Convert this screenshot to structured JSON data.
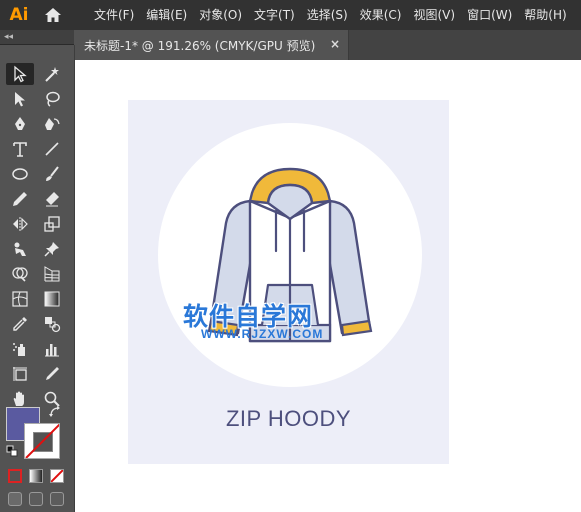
{
  "app": {
    "logo": "Ai"
  },
  "menu": [
    "文件(F)",
    "编辑(E)",
    "对象(O)",
    "文字(T)",
    "选择(S)",
    "效果(C)",
    "视图(V)",
    "窗口(W)",
    "帮助(H)"
  ],
  "document_tab": {
    "label": "未标题-1* @ 191.26% (CMYK/GPU 预览)",
    "close": "×"
  },
  "toolbar": {
    "collapse": "◂◂",
    "tools": [
      "selection-tool-icon",
      "magic-wand-tool-icon",
      "direct-selection-tool-icon",
      "lasso-tool-icon",
      "pen-tool-icon",
      "curvature-tool-icon",
      "type-tool-icon",
      "line-tool-icon",
      "ellipse-tool-icon",
      "paintbrush-tool-icon",
      "pencil-tool-icon",
      "eraser-tool-icon",
      "reflect-tool-icon",
      "scale-tool-icon",
      "puppet-warp-tool-icon",
      "pin-tool-icon",
      "shape-builder-tool-icon",
      "perspective-grid-tool-icon",
      "mesh-tool-icon",
      "gradient-tool-icon",
      "eyedropper-tool-icon",
      "blend-tool-icon",
      "symbol-sprayer-tool-icon",
      "column-graph-tool-icon",
      "artboard-tool-icon",
      "slice-tool-icon",
      "hand-tool-icon",
      "zoom-tool-icon"
    ],
    "fill_color": "#5a5aa0",
    "stroke_color": "none"
  },
  "artboard": {
    "title": "ZIP HOODY",
    "background": "#edeef8",
    "hoodie_colors": {
      "body": "#ffffff",
      "sleeves": "#d3daea",
      "hood": "#f0b93a",
      "outline": "#4d4f7d"
    }
  },
  "watermark": {
    "text": "软件自学网",
    "url": "WWW.RJZXW.COM"
  }
}
